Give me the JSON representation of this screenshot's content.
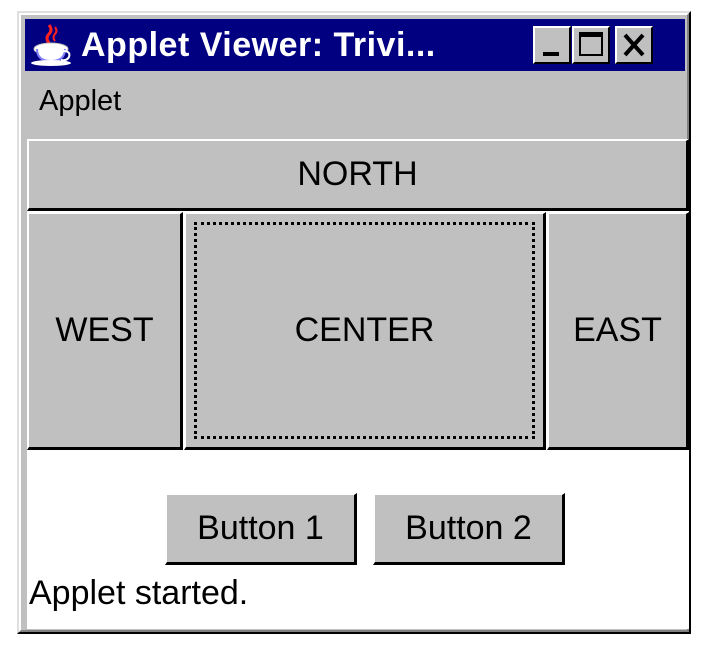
{
  "window": {
    "title": "Applet Viewer: Trivi...",
    "controls": {
      "minimize": "minimize-icon",
      "maximize": "maximize-icon",
      "close": "close-icon"
    }
  },
  "menubar": {
    "items": [
      {
        "label": "Applet"
      }
    ]
  },
  "layout": {
    "north": "NORTH",
    "west": "WEST",
    "center": "CENTER",
    "east": "EAST"
  },
  "buttons": {
    "button1": "Button 1",
    "button2": "Button 2"
  },
  "status": "Applet started.",
  "colors": {
    "titlebar": "#000080",
    "face": "#c0c0c0",
    "client": "#ffffff"
  }
}
